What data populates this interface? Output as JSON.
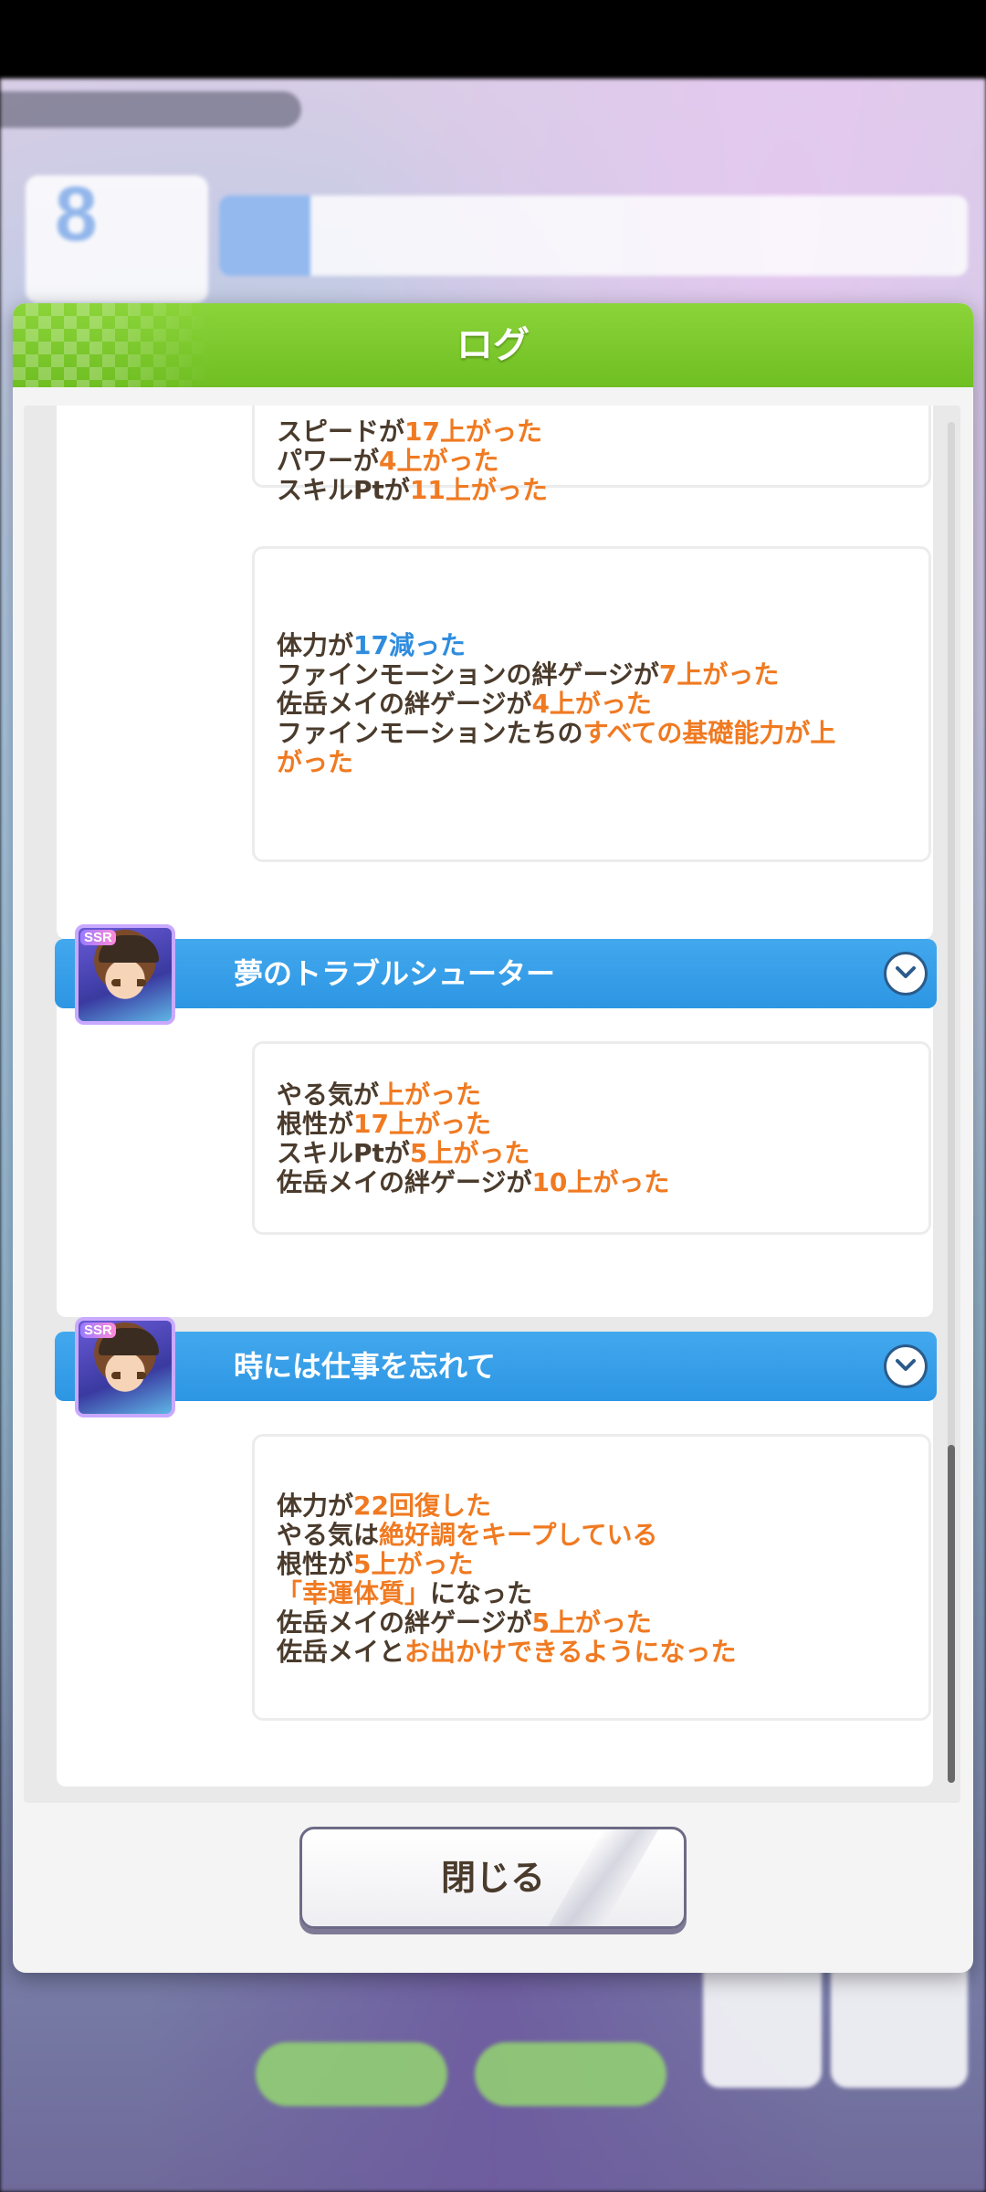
{
  "background": {
    "turn_number": "8"
  },
  "modal": {
    "title": "ログ",
    "close_label": "閉じる"
  },
  "entries": [
    {
      "lines": [
        {
          "parts": [
            {
              "t": "スピードが"
            },
            {
              "t": "17上がった",
              "c": "orange"
            }
          ]
        },
        {
          "parts": [
            {
              "t": "パワーが"
            },
            {
              "t": "4上がった",
              "c": "orange"
            }
          ]
        },
        {
          "parts": [
            {
              "t": "スキルPtが"
            },
            {
              "t": "11上がった",
              "c": "orange"
            }
          ]
        }
      ]
    },
    {
      "lines": [
        {
          "parts": [
            {
              "t": "体力が"
            },
            {
              "t": "17減った",
              "c": "blue"
            }
          ]
        },
        {
          "parts": [
            {
              "t": "ファインモーションの絆ゲージが"
            },
            {
              "t": "7上がった",
              "c": "orange"
            }
          ]
        },
        {
          "parts": [
            {
              "t": "佐岳メイの絆ゲージが"
            },
            {
              "t": "4上がった",
              "c": "orange"
            }
          ]
        },
        {
          "parts": [
            {
              "t": "ファインモーションたちの"
            },
            {
              "t": "すべての基礎能力が上がった",
              "c": "orange"
            }
          ]
        }
      ]
    }
  ],
  "events": [
    {
      "title": "夢のトラブルシューター",
      "badge": "SSR",
      "lines": [
        {
          "parts": [
            {
              "t": "やる気が"
            },
            {
              "t": "上がった",
              "c": "orange"
            }
          ]
        },
        {
          "parts": [
            {
              "t": "根性が"
            },
            {
              "t": "17上がった",
              "c": "orange"
            }
          ]
        },
        {
          "parts": [
            {
              "t": "スキルPtが"
            },
            {
              "t": "5上がった",
              "c": "orange"
            }
          ]
        },
        {
          "parts": [
            {
              "t": "佐岳メイの絆ゲージが"
            },
            {
              "t": "10上がった",
              "c": "orange"
            }
          ]
        }
      ]
    },
    {
      "title": "時には仕事を忘れて",
      "badge": "SSR",
      "lines": [
        {
          "parts": [
            {
              "t": "体力が"
            },
            {
              "t": "22回復した",
              "c": "orange"
            }
          ]
        },
        {
          "parts": [
            {
              "t": "やる気は"
            },
            {
              "t": "絶好調をキープしている",
              "c": "orange"
            }
          ]
        },
        {
          "parts": [
            {
              "t": "根性が"
            },
            {
              "t": "5上がった",
              "c": "orange"
            }
          ]
        },
        {
          "parts": [
            {
              "t": "「幸運体質」",
              "c": "orange"
            },
            {
              "t": "になった"
            }
          ]
        },
        {
          "parts": [
            {
              "t": "佐岳メイの絆ゲージが"
            },
            {
              "t": "5上がった",
              "c": "orange"
            }
          ]
        },
        {
          "parts": [
            {
              "t": "佐岳メイと"
            },
            {
              "t": "お出かけできるようになった",
              "c": "orange"
            }
          ]
        }
      ]
    }
  ],
  "colors": {
    "header_green": "#7cc82e",
    "event_blue": "#3aa2ea",
    "highlight_orange": "#f07a21",
    "highlight_blue": "#2f8cde",
    "body_text": "#4a3b2c"
  }
}
